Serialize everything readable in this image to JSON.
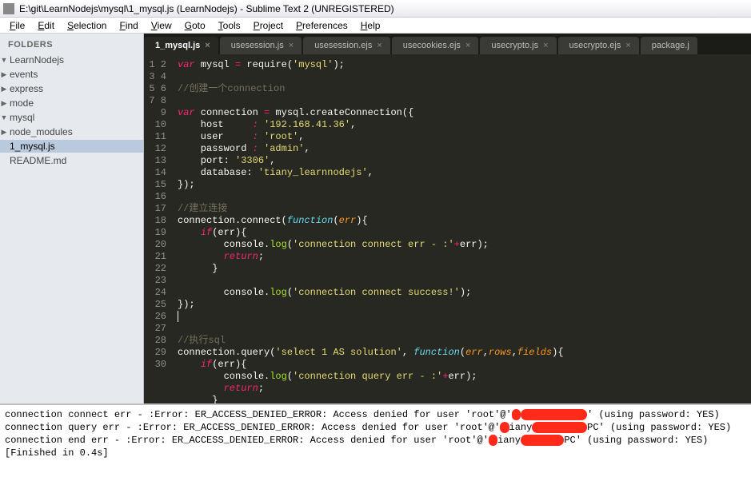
{
  "window": {
    "title": "E:\\git\\LearnNodejs\\mysql\\1_mysql.js (LearnNodejs) - Sublime Text 2 (UNREGISTERED)"
  },
  "menu": [
    "File",
    "Edit",
    "Selection",
    "Find",
    "View",
    "Goto",
    "Tools",
    "Project",
    "Preferences",
    "Help"
  ],
  "sidebar": {
    "heading": "FOLDERS",
    "tree": [
      {
        "label": "LearnNodejs",
        "depth": 0,
        "arrow": "open"
      },
      {
        "label": "events",
        "depth": 1,
        "arrow": "closed"
      },
      {
        "label": "express",
        "depth": 1,
        "arrow": "closed"
      },
      {
        "label": "mode",
        "depth": 1,
        "arrow": "closed"
      },
      {
        "label": "mysql",
        "depth": 1,
        "arrow": "open"
      },
      {
        "label": "node_modules",
        "depth": 2,
        "arrow": "closed"
      },
      {
        "label": "1_mysql.js",
        "depth": 2,
        "arrow": "none",
        "selected": true
      },
      {
        "label": "README.md",
        "depth": 1,
        "arrow": "none"
      }
    ]
  },
  "tabs": [
    {
      "label": "1_mysql.js",
      "active": true,
      "close": true
    },
    {
      "label": "usesession.js",
      "active": false,
      "close": true
    },
    {
      "label": "usesession.ejs",
      "active": false,
      "close": true
    },
    {
      "label": "usecookies.ejs",
      "active": false,
      "close": true
    },
    {
      "label": "usecrypto.js",
      "active": false,
      "close": true
    },
    {
      "label": "usecrypto.ejs",
      "active": false,
      "close": true
    },
    {
      "label": "package.j",
      "active": false,
      "close": false
    }
  ],
  "code": {
    "first_line": 1,
    "last_line": 30,
    "cursor_line": 22,
    "lines": [
      [
        [
          "kw",
          "var"
        ],
        [
          "id",
          " mysql "
        ],
        [
          "kw",
          "="
        ],
        [
          "id",
          " require("
        ],
        [
          "str",
          "'mysql'"
        ],
        [
          "id",
          ");"
        ]
      ],
      [],
      [
        [
          "cm",
          "//创建一个connection"
        ]
      ],
      [],
      [
        [
          "kw",
          "var"
        ],
        [
          "id",
          " connection "
        ],
        [
          "kw",
          "="
        ],
        [
          "id",
          " mysql.createConnection({"
        ]
      ],
      [
        [
          "id",
          "    host     "
        ],
        [
          "kw",
          ":"
        ],
        [
          "id",
          " "
        ],
        [
          "str",
          "'192.168.41.36'"
        ],
        [
          "id",
          ","
        ]
      ],
      [
        [
          "id",
          "    user     "
        ],
        [
          "kw",
          ":"
        ],
        [
          "id",
          " "
        ],
        [
          "str",
          "'root'"
        ],
        [
          "id",
          ","
        ]
      ],
      [
        [
          "id",
          "    password "
        ],
        [
          "kw",
          ":"
        ],
        [
          "id",
          " "
        ],
        [
          "str",
          "'admin'"
        ],
        [
          "id",
          ","
        ]
      ],
      [
        [
          "id",
          "    port: "
        ],
        [
          "str",
          "'3306'"
        ],
        [
          "id",
          ","
        ]
      ],
      [
        [
          "id",
          "    database: "
        ],
        [
          "str",
          "'tiany_learnnodejs'"
        ],
        [
          "id",
          ","
        ]
      ],
      [
        [
          "id",
          "});"
        ]
      ],
      [],
      [
        [
          "cm",
          "//建立连接"
        ]
      ],
      [
        [
          "id",
          "connection.connect("
        ],
        [
          "fn",
          "function"
        ],
        [
          "id",
          "("
        ],
        [
          "pa",
          "err"
        ],
        [
          "id",
          "){"
        ]
      ],
      [
        [
          "id",
          "    "
        ],
        [
          "kw",
          "if"
        ],
        [
          "id",
          "(err){"
        ]
      ],
      [
        [
          "id",
          "        console."
        ],
        [
          "nm",
          "log"
        ],
        [
          "id",
          "("
        ],
        [
          "str",
          "'connection connect err - :'"
        ],
        [
          "kw",
          "+"
        ],
        [
          "id",
          "err);"
        ]
      ],
      [
        [
          "id",
          "        "
        ],
        [
          "kw",
          "return"
        ],
        [
          "id",
          ";"
        ]
      ],
      [
        [
          "id",
          "      }"
        ]
      ],
      [],
      [
        [
          "id",
          "        console."
        ],
        [
          "nm",
          "log"
        ],
        [
          "id",
          "("
        ],
        [
          "str",
          "'connection connect success!'"
        ],
        [
          "id",
          ");"
        ]
      ],
      [
        [
          "id",
          "});"
        ]
      ],
      [],
      [],
      [
        [
          "cm",
          "//执行sql"
        ]
      ],
      [
        [
          "id",
          "connection.query("
        ],
        [
          "str",
          "'select 1 AS solution'"
        ],
        [
          "id",
          ", "
        ],
        [
          "fn",
          "function"
        ],
        [
          "id",
          "("
        ],
        [
          "pa",
          "err"
        ],
        [
          "id",
          ","
        ],
        [
          "pa",
          "rows"
        ],
        [
          "id",
          ","
        ],
        [
          "pa",
          "fields"
        ],
        [
          "id",
          "){"
        ]
      ],
      [
        [
          "id",
          "    "
        ],
        [
          "kw",
          "if"
        ],
        [
          "id",
          "(err){"
        ]
      ],
      [
        [
          "id",
          "        console."
        ],
        [
          "nm",
          "log"
        ],
        [
          "id",
          "("
        ],
        [
          "str",
          "'connection query err - :'"
        ],
        [
          "kw",
          "+"
        ],
        [
          "id",
          "err);"
        ]
      ],
      [
        [
          "id",
          "        "
        ],
        [
          "kw",
          "return"
        ],
        [
          "id",
          ";"
        ]
      ],
      [
        [
          "id",
          "      }"
        ]
      ],
      []
    ]
  },
  "console": {
    "lines": [
      {
        "pre": "connection connect err - :Error: ER_ACCESS_DENIED_ERROR: Access denied for user 'root'@'",
        "mask1": "t",
        "mid": "",
        "mask2": "iany-----PC",
        "post": "' (using password: YES)"
      },
      {
        "pre": "connection query err - :Error: ER_ACCESS_DENIED_ERROR: Access denied for user 'root'@'",
        "mask1": "t",
        "mid": "iany",
        "mask2": "---------",
        "post": "PC' (using password: YES)"
      },
      {
        "pre": "connection end err - :Error: ER_ACCESS_DENIED_ERROR: Access denied for user 'root'@'",
        "mask1": "t",
        "mid": "iany",
        "mask2": "-------",
        "post": "PC' (using password: YES)"
      }
    ],
    "finished": "[Finished in 0.4s]"
  }
}
